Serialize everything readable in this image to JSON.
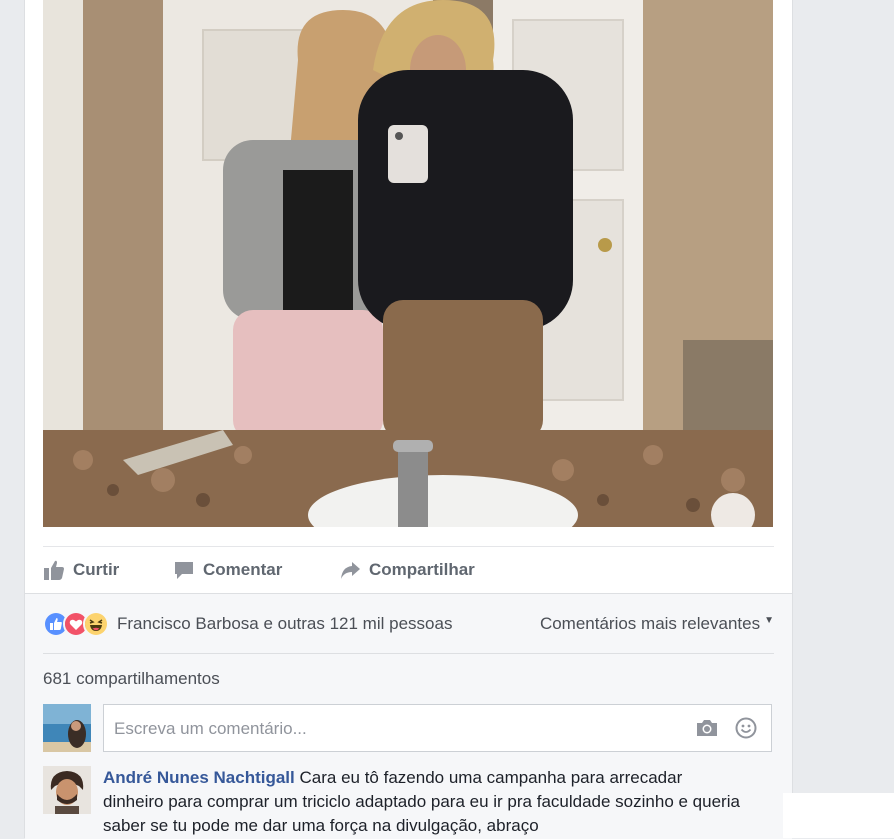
{
  "actions": {
    "like_label": "Curtir",
    "comment_label": "Comentar",
    "share_label": "Compartilhar"
  },
  "reactions": {
    "icons": [
      "like-icon",
      "love-icon",
      "haha-icon"
    ],
    "summary": "Francisco Barbosa e outras 121 mil pessoas",
    "sort_label": "Comentários mais relevantes"
  },
  "shares": {
    "count_label": "681 compartilhamentos"
  },
  "composer": {
    "placeholder": "Escreva um comentário..."
  },
  "comment": {
    "author": "André Nunes Nachtigall",
    "text": "Cara eu tô fazendo uma campanha para arrecadar dinheiro para comprar um triciclo adaptado para eu ir pra faculdade sozinho e queria saber se tu pode me dar uma força na divulgação, abraço"
  },
  "colors": {
    "link": "#365899",
    "like_blue": "#5890ff",
    "love_red": "#f25268",
    "haha_yellow": "#fcd36e"
  }
}
